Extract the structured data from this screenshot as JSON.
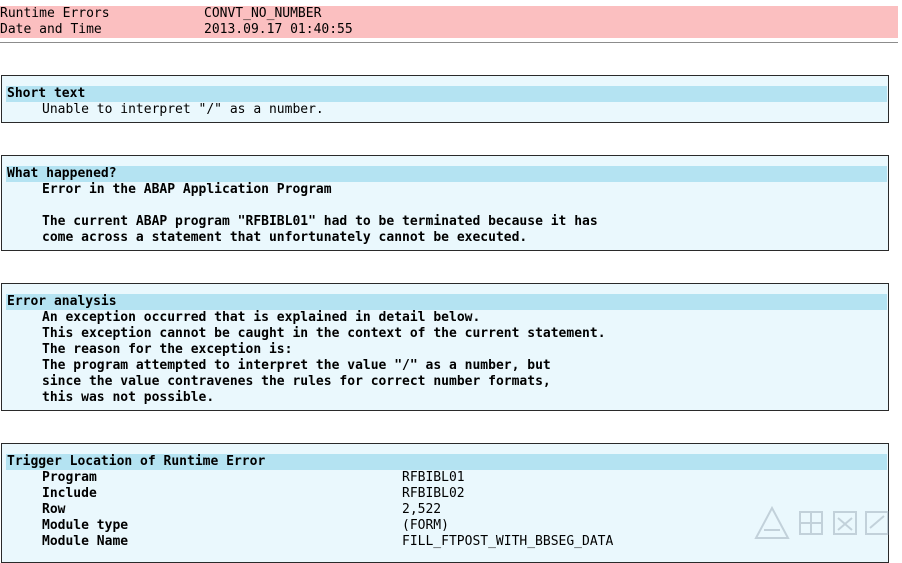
{
  "header": {
    "rows": [
      {
        "label": "Runtime Errors",
        "value": "CONVT_NO_NUMBER"
      },
      {
        "label": "Date and Time",
        "value": "2013.09.17 01:40:55"
      }
    ]
  },
  "short_text": {
    "title": "Short text",
    "lines": [
      "Unable to interpret \"/\" as a number."
    ]
  },
  "what_happened": {
    "title": "What happened?",
    "lines": [
      "Error in the ABAP Application Program",
      "",
      "The current ABAP program \"RFBIBL01\" had to be terminated because it has",
      "come across a statement that unfortunately cannot be executed."
    ]
  },
  "error_analysis": {
    "title": "Error analysis",
    "lines": [
      "An exception occurred that is explained in detail below.",
      "This exception cannot be caught in the context of the current statement.",
      "The reason for the exception is:",
      "The program attempted to interpret the value \"/\" as a number, but",
      "since the value contravenes the rules for correct number formats,",
      "this was not possible."
    ]
  },
  "trigger_location": {
    "title": "Trigger Location of Runtime Error",
    "rows": [
      {
        "label": "Program",
        "value": "RFBIBL01"
      },
      {
        "label": "Include",
        "value": "RFBIBL02"
      },
      {
        "label": "Row",
        "value": "2,522"
      },
      {
        "label": "Module type",
        "value": "(FORM)"
      },
      {
        "label": "Module Name",
        "value": "FILL_FTPOST_WITH_BBSEG_DATA"
      }
    ]
  },
  "watermark": {
    "icon": "watermark-logo-icon"
  }
}
